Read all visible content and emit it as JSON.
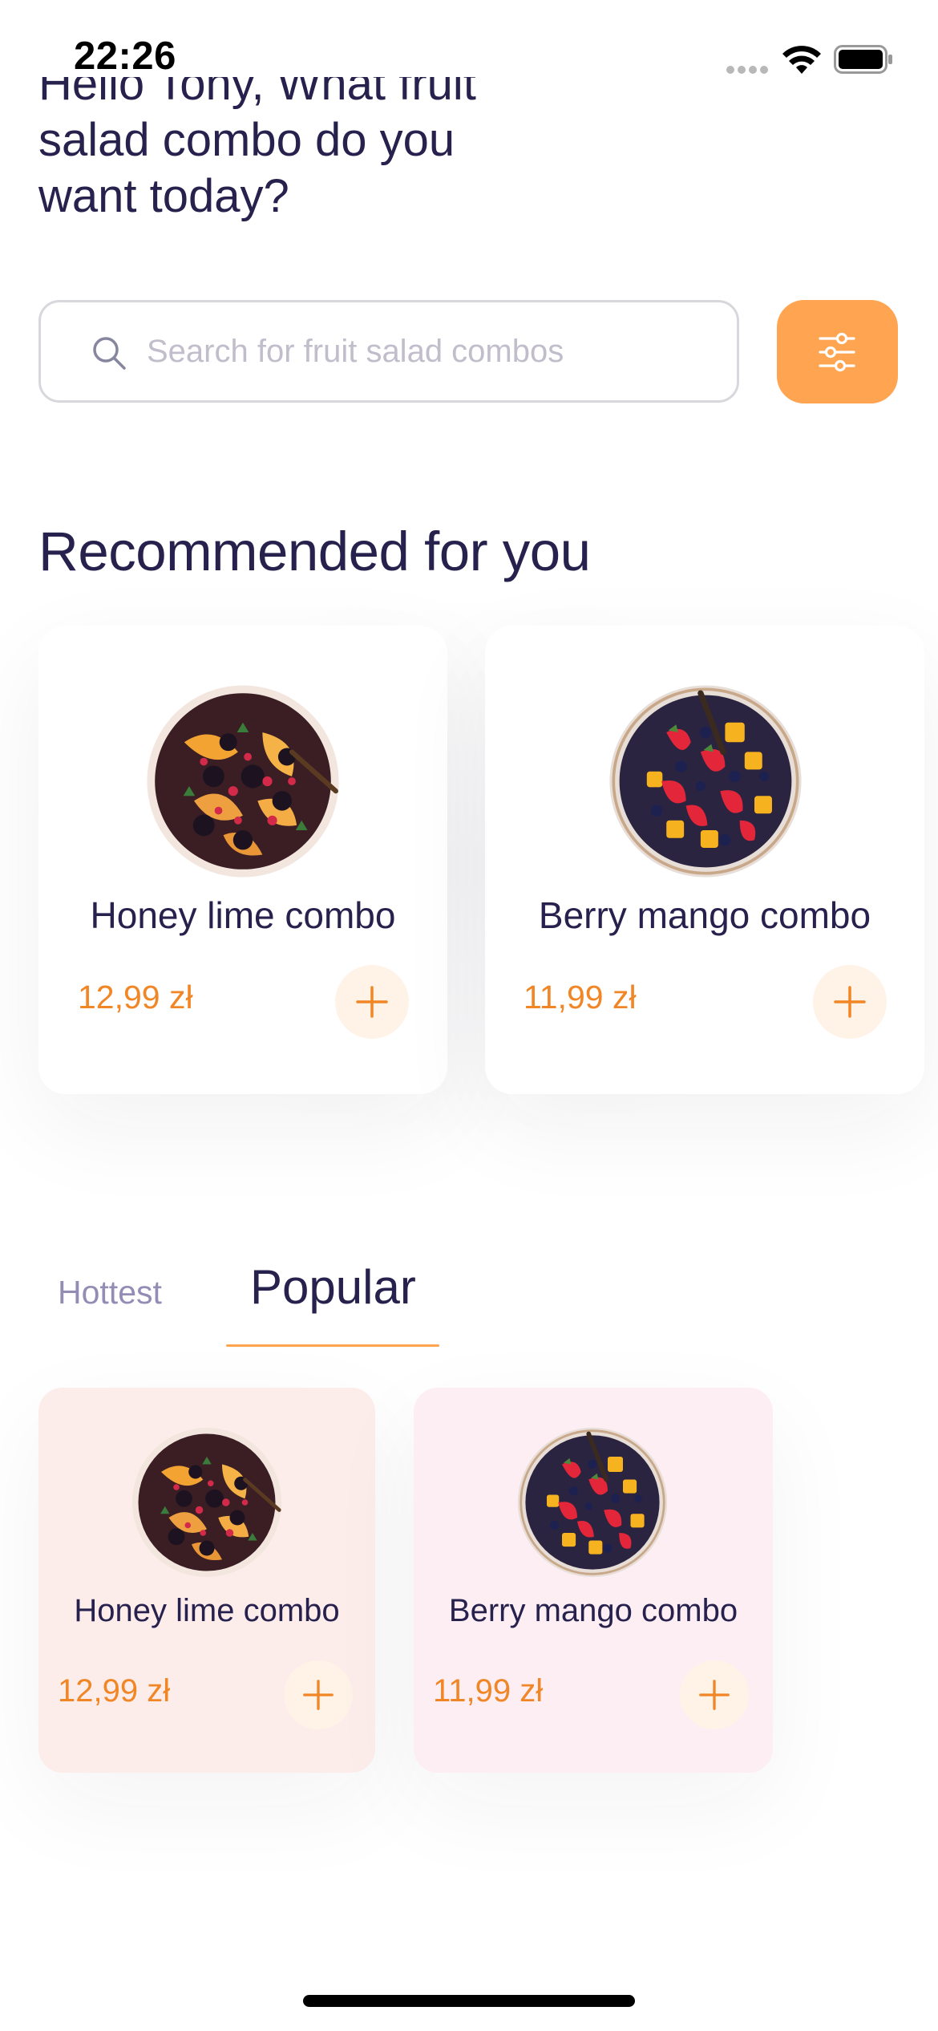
{
  "status_bar": {
    "time": "22:26",
    "icons": [
      "cellular-signal-icon",
      "wifi-icon",
      "battery-icon"
    ]
  },
  "greeting": {
    "line_1": "Hello Tony, What fruit",
    "line_2": "salad combo do you",
    "line_3": "want today?"
  },
  "search": {
    "placeholder": "Search for fruit salad combos",
    "value": "",
    "icon": "search-icon",
    "filter_icon": "sliders-icon"
  },
  "recommended": {
    "title": "Recommended for you",
    "items": [
      {
        "name": "Honey lime combo",
        "price": "12,99 zł",
        "image": "fruit-bowl-peach-berries",
        "add_icon": "plus-icon"
      },
      {
        "name": "Berry mango combo",
        "price": "11,99 zł",
        "image": "fruit-bowl-strawberry-mango",
        "add_icon": "plus-icon"
      }
    ]
  },
  "tabs": {
    "items": [
      {
        "label": "Hottest",
        "active": false
      },
      {
        "label": "Popular",
        "active": true
      }
    ]
  },
  "popular": {
    "items": [
      {
        "name": "Honey lime combo",
        "price": "12,99 zł",
        "card_color": "#FCEDEB",
        "image": "fruit-bowl-peach-berries"
      },
      {
        "name": "Berry mango combo",
        "price": "11,99 zł",
        "card_color": "#FDEEF3",
        "image": "fruit-bowl-strawberry-mango"
      }
    ]
  },
  "colors": {
    "accent": "#FFA451",
    "price": "#F08626",
    "heading": "#27214D",
    "inactive_tab": "#938DB5",
    "add_button_bg": "#FFF2E7"
  }
}
